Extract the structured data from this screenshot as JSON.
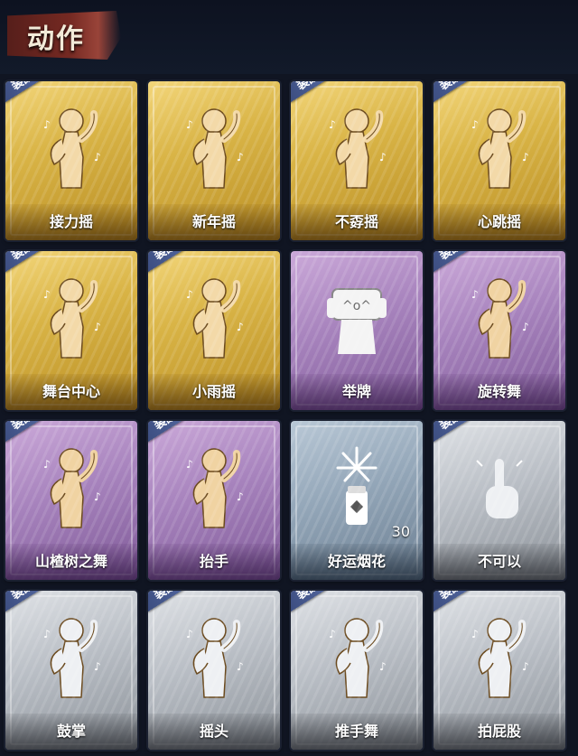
{
  "header": {
    "title": "动作"
  },
  "badge_label": "装配",
  "cards": [
    {
      "label": "接力摇",
      "tier": "gold",
      "equipped": true,
      "icon": "dance-pose-icon"
    },
    {
      "label": "新年摇",
      "tier": "gold",
      "equipped": false,
      "icon": "dance-pose-icon"
    },
    {
      "label": "不孬摇",
      "tier": "gold",
      "equipped": true,
      "icon": "dance-pose-icon"
    },
    {
      "label": "心跳摇",
      "tier": "gold",
      "equipped": true,
      "icon": "dance-pose-icon"
    },
    {
      "label": "舞台中心",
      "tier": "gold",
      "equipped": true,
      "icon": "dance-pose-icon"
    },
    {
      "label": "小雨摇",
      "tier": "gold",
      "equipped": true,
      "icon": "dance-pose-icon"
    },
    {
      "label": "举牌",
      "tier": "purple",
      "equipped": false,
      "icon": "sign-hold-icon"
    },
    {
      "label": "旋转舞",
      "tier": "purple",
      "equipped": true,
      "icon": "spin-dance-icon"
    },
    {
      "label": "山楂树之舞",
      "tier": "purple",
      "equipped": true,
      "icon": "dance-pose-icon"
    },
    {
      "label": "抬手",
      "tier": "purple",
      "equipped": true,
      "icon": "raise-hand-icon"
    },
    {
      "label": "好运烟花",
      "tier": "blue",
      "equipped": false,
      "icon": "firework-icon",
      "count": "30"
    },
    {
      "label": "不可以",
      "tier": "silver",
      "equipped": true,
      "icon": "finger-wag-icon"
    },
    {
      "label": "鼓掌",
      "tier": "silver",
      "equipped": true,
      "icon": "clap-icon"
    },
    {
      "label": "摇头",
      "tier": "silver",
      "equipped": true,
      "icon": "head-shake-icon"
    },
    {
      "label": "推手舞",
      "tier": "silver",
      "equipped": true,
      "icon": "push-dance-icon"
    },
    {
      "label": "拍屁股",
      "tier": "silver",
      "equipped": true,
      "icon": "pat-icon"
    }
  ],
  "colors": {
    "gold": "#d9b446",
    "purple": "#a783bd",
    "blue": "#93a6b8",
    "silver": "#b9bec5",
    "badge": "#4a5c92"
  }
}
